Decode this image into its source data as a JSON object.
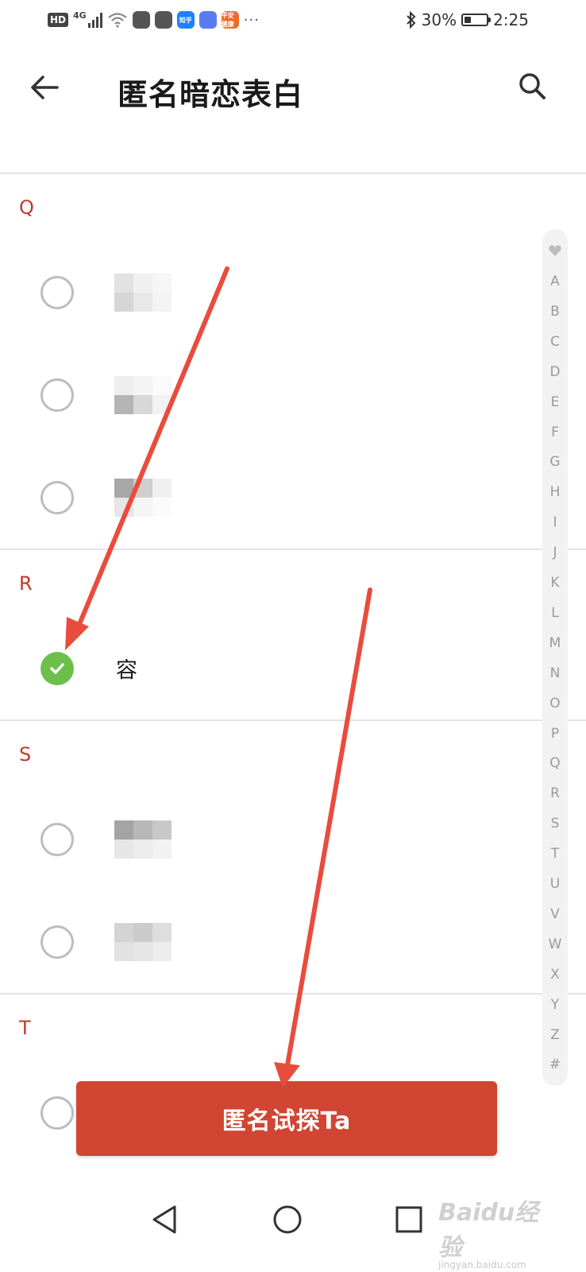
{
  "status_bar": {
    "hd": "HD",
    "network": "4G",
    "app_icons": [
      {
        "name": "game-icon",
        "color": "#555555",
        "text": ""
      },
      {
        "name": "chat-icon",
        "color": "#555555",
        "text": ""
      },
      {
        "name": "zhihu-icon",
        "color": "#1e80ff",
        "text": "知乎"
      },
      {
        "name": "music-icon",
        "color": "#5b7cf0",
        "text": ""
      },
      {
        "name": "health-icon",
        "color": "#f06b2a",
        "text": "平安健康"
      }
    ],
    "more": "···",
    "battery": "30%",
    "battery_level": 0.3,
    "time": "2:25"
  },
  "header": {
    "title": "匿名暗恋表白"
  },
  "sections": [
    {
      "letter": "Q",
      "contacts": [
        {
          "name": "",
          "checked": false,
          "redacted": true
        },
        {
          "name": "",
          "checked": false,
          "redacted": true
        },
        {
          "name": "",
          "checked": false,
          "redacted": true
        }
      ]
    },
    {
      "letter": "R",
      "contacts": [
        {
          "name": "容",
          "checked": true,
          "redacted": false
        }
      ]
    },
    {
      "letter": "S",
      "contacts": [
        {
          "name": "",
          "checked": false,
          "redacted": true
        },
        {
          "name": "",
          "checked": false,
          "redacted": true
        }
      ]
    },
    {
      "letter": "T",
      "contacts": [
        {
          "name": "",
          "checked": false,
          "redacted": true
        }
      ]
    }
  ],
  "alphabet_index": [
    "A",
    "B",
    "C",
    "D",
    "E",
    "F",
    "G",
    "H",
    "I",
    "J",
    "K",
    "L",
    "M",
    "N",
    "O",
    "P",
    "Q",
    "R",
    "S",
    "T",
    "U",
    "V",
    "W",
    "X",
    "Y",
    "Z",
    "#"
  ],
  "action_button": {
    "label": "匿名试探Ta"
  },
  "colors": {
    "accent_red": "#d14532",
    "section_letter": "#c0392b",
    "checked_green": "#6cc04a",
    "annotation_arrow": "#e84c3d"
  },
  "watermark": {
    "main": "Baidu经验",
    "sub": "jingyan.baidu.com"
  }
}
